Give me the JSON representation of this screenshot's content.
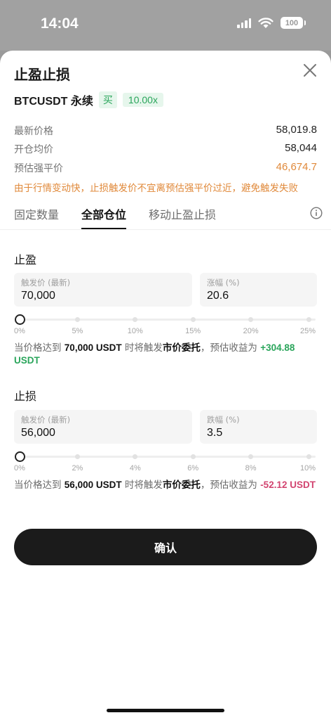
{
  "status_bar": {
    "time": "14:04",
    "battery": "100"
  },
  "sheet": {
    "title": "止盈止损",
    "pair": "BTCUSDT",
    "contract_type": "永续",
    "side": "买",
    "leverage": "10.00x"
  },
  "prices": [
    {
      "label": "最新价格",
      "value": "58,019.8"
    },
    {
      "label": "开仓均价",
      "value": "58,044"
    },
    {
      "label": "预估强平价",
      "value": "46,674.7"
    }
  ],
  "warning": "由于行情变动快，止损触发价不宜离预估强平价过近，避免触发失败",
  "tabs": [
    {
      "label": "固定数量"
    },
    {
      "label": "全部仓位"
    },
    {
      "label": "移动止盈止损"
    }
  ],
  "active_tab": "全部仓位",
  "take_profit": {
    "title": "止盈",
    "trigger_label": "触发价 (最新)",
    "trigger_value": "70,000",
    "pct_label": "涨幅 (%)",
    "pct_value": "20.6",
    "slider_level_pct": 0,
    "ticks": [
      "0%",
      "5%",
      "10%",
      "15%",
      "20%",
      "25%"
    ],
    "desc": {
      "p1": "当价格达到 ",
      "price": "70,000 USDT",
      "p2": " 时将触发",
      "order": "市价委托",
      "p3": "，预估收益为 ",
      "pnl": "+304.88 USDT"
    }
  },
  "stop_loss": {
    "title": "止损",
    "trigger_label": "触发价 (最新)",
    "trigger_value": "56,000",
    "pct_label": "跌幅 (%)",
    "pct_value": "3.5",
    "slider_level_pct": 0,
    "ticks": [
      "0%",
      "2%",
      "4%",
      "6%",
      "8%",
      "10%"
    ],
    "desc": {
      "p1": "当价格达到 ",
      "price": "56,000 USDT",
      "p2": " 时将触发",
      "order": "市价委托",
      "p3": "，预估收益为 ",
      "pnl": "-52.12 USDT"
    }
  },
  "confirm_label": "确认",
  "colors": {
    "profit": "#2aa55b",
    "loss": "#d24470",
    "warning": "#e0893a",
    "button": "#1b1b1b"
  },
  "icons": [
    "close-icon",
    "info-icon",
    "signal-icon",
    "wifi-icon",
    "battery-icon"
  ]
}
